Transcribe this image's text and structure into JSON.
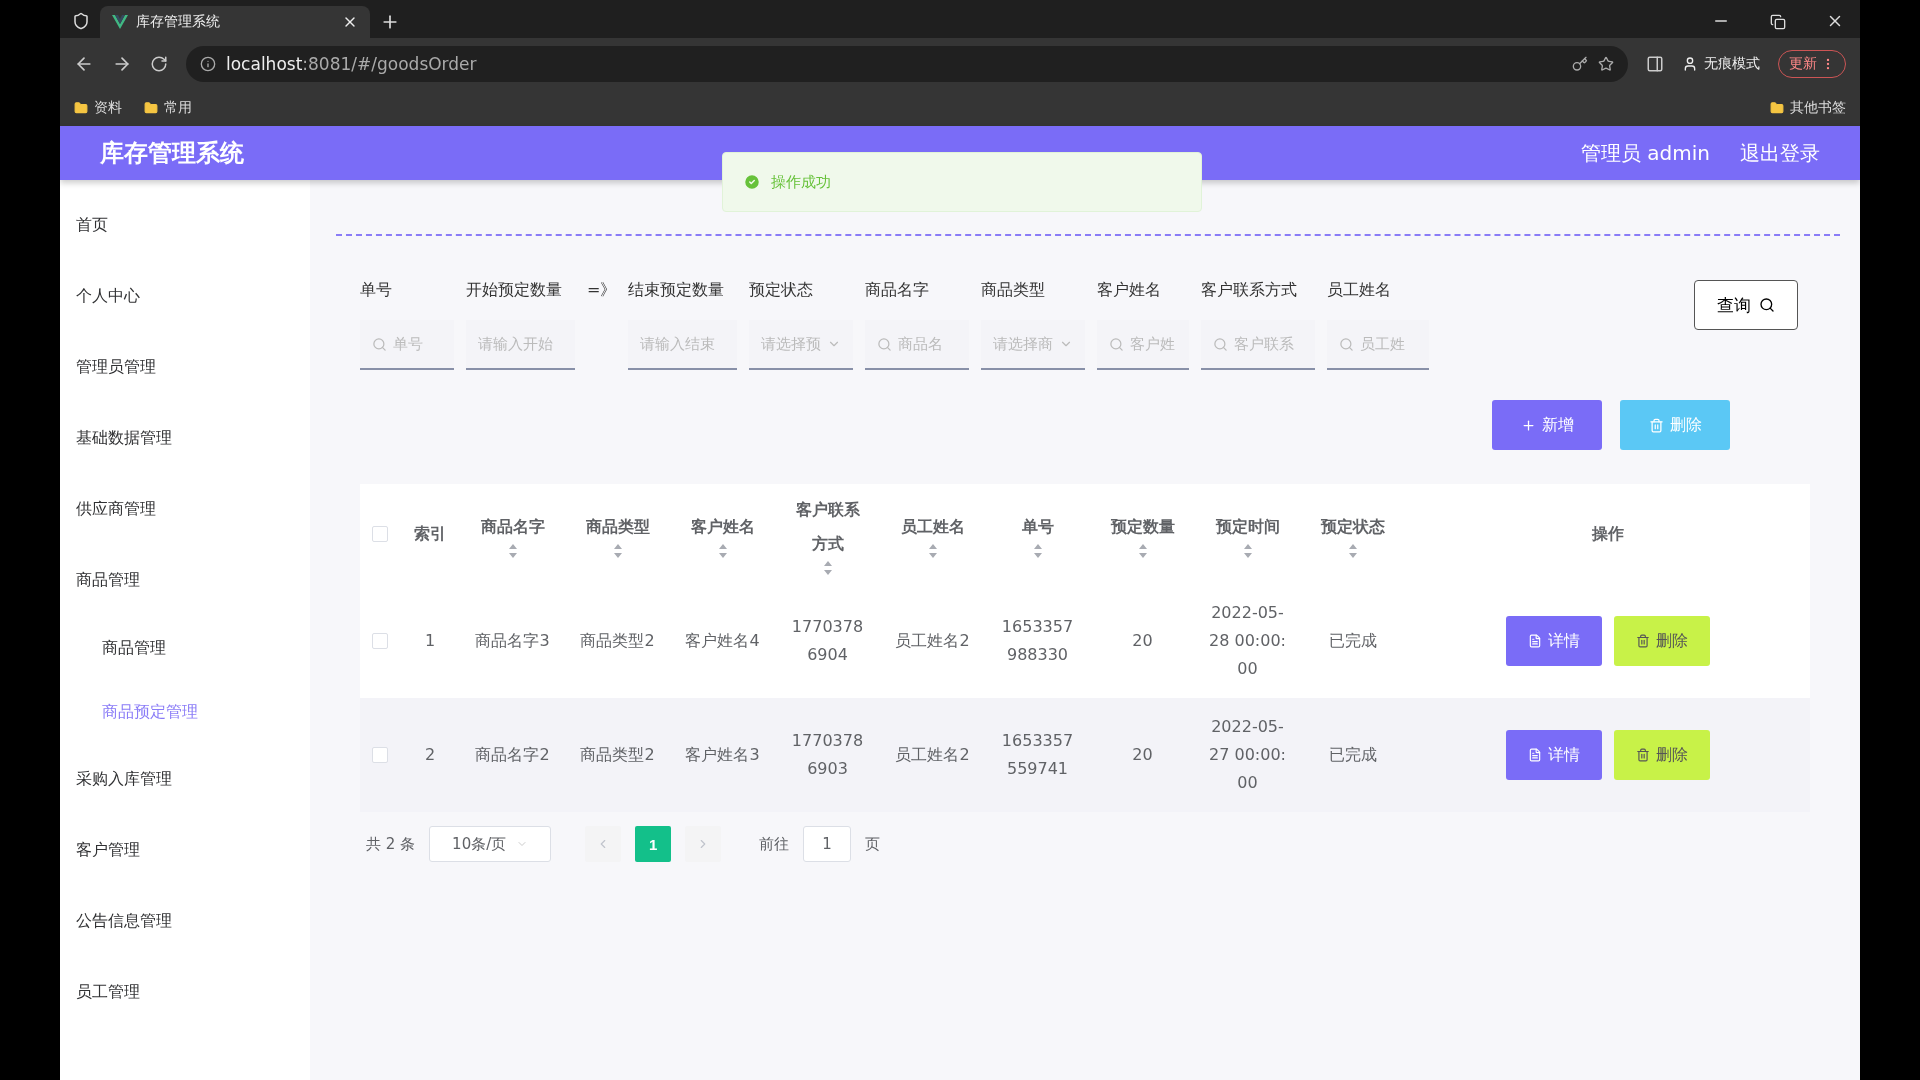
{
  "browser": {
    "tab_title": "库存管理系统",
    "url_host": "localhost",
    "url_rest": ":8081/#/goodsOrder",
    "incognito": "无痕模式",
    "update": "更新",
    "bookmarks": [
      "资料",
      "常用"
    ],
    "other_bookmarks": "其他书签"
  },
  "header": {
    "title": "库存管理系统",
    "user": "管理员 admin",
    "logout": "退出登录"
  },
  "toast": {
    "text": "操作成功"
  },
  "sidebar": [
    {
      "label": "首页",
      "selected": false
    },
    {
      "label": "个人中心",
      "selected": false
    },
    {
      "label": "管理员管理",
      "selected": false
    },
    {
      "label": "基础数据管理",
      "selected": false
    },
    {
      "label": "供应商管理",
      "selected": false
    },
    {
      "label": "商品管理",
      "selected": false,
      "children": [
        {
          "label": "商品管理",
          "selected": false
        },
        {
          "label": "商品预定管理",
          "selected": true
        }
      ]
    },
    {
      "label": "采购入库管理",
      "selected": false
    },
    {
      "label": "客户管理",
      "selected": false
    },
    {
      "label": "公告信息管理",
      "selected": false
    },
    {
      "label": "员工管理",
      "selected": false
    }
  ],
  "filters": [
    {
      "label": "单号",
      "kind": "search",
      "placeholder": "单号"
    },
    {
      "label": "开始预定数量",
      "kind": "text",
      "placeholder": "请输入开始"
    },
    {
      "label": "=》",
      "kind": "separator"
    },
    {
      "label": "结束预定数量",
      "kind": "text",
      "placeholder": "请输入结束"
    },
    {
      "label": "预定状态",
      "kind": "select",
      "placeholder": "请选择预"
    },
    {
      "label": "商品名字",
      "kind": "search",
      "placeholder": "商品名"
    },
    {
      "label": "商品类型",
      "kind": "select",
      "placeholder": "请选择商"
    },
    {
      "label": "客户姓名",
      "kind": "search",
      "placeholder": "客户姓"
    },
    {
      "label": "客户联系方式",
      "kind": "search",
      "placeholder": "客户联系"
    },
    {
      "label": "员工姓名",
      "kind": "search",
      "placeholder": "员工姓"
    }
  ],
  "query_button": "查询",
  "actions": [
    {
      "label": "新增",
      "kind": "add"
    },
    {
      "label": "删除",
      "kind": "delete"
    }
  ],
  "table": {
    "all_checked": false,
    "columns": [
      {
        "label": "索引",
        "sortable": false
      },
      {
        "label": "商品名字",
        "sortable": true
      },
      {
        "label": "商品类型",
        "sortable": true
      },
      {
        "label": "客户姓名",
        "sortable": true
      },
      {
        "label": "客户联系方式",
        "sortable": true
      },
      {
        "label": "员工姓名",
        "sortable": true
      },
      {
        "label": "单号",
        "sortable": true
      },
      {
        "label": "预定数量",
        "sortable": true
      },
      {
        "label": "预定时间",
        "sortable": true
      },
      {
        "label": "预定状态",
        "sortable": true
      },
      {
        "label": "操作",
        "sortable": false
      }
    ],
    "rows": [
      {
        "checked": false,
        "cells": [
          "1",
          "商品名字3",
          "商品类型2",
          "客户姓名4",
          "17703786904",
          "员工姓名2",
          "1653357988330",
          "20",
          "2022-05-28 00:00:00",
          "已完成"
        ],
        "buttons": [
          "详情",
          "删除"
        ]
      },
      {
        "checked": false,
        "cells": [
          "2",
          "商品名字2",
          "商品类型2",
          "客户姓名3",
          "17703786903",
          "员工姓名2",
          "1653357559741",
          "20",
          "2022-05-27 00:00:00",
          "已完成"
        ],
        "buttons": [
          "详情",
          "删除"
        ]
      }
    ]
  },
  "pagination": {
    "total": "共 2 条",
    "page_size": "10条/页",
    "pages": [
      {
        "label": "1",
        "selected": true
      }
    ],
    "goto": "前往",
    "goto_value": "1",
    "page_suffix": "页"
  }
}
